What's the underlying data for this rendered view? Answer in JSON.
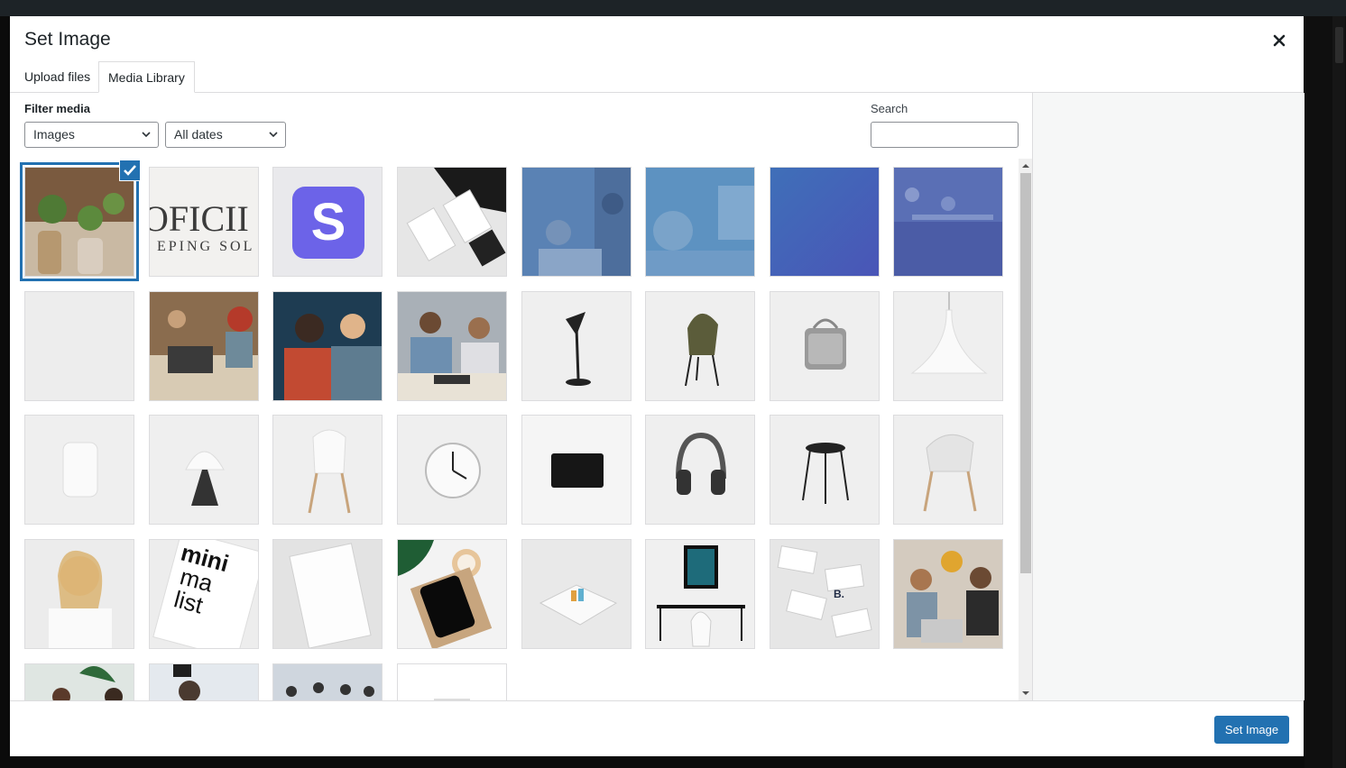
{
  "modal": {
    "title": "Set Image",
    "tabs": [
      {
        "label": "Upload files",
        "active": false
      },
      {
        "label": "Media Library",
        "active": true
      }
    ]
  },
  "toolbar": {
    "filter_label": "Filter media",
    "type_select": {
      "value": "Images"
    },
    "date_select": {
      "value": "All dates"
    },
    "search_label": "Search",
    "search_value": ""
  },
  "media_items": [
    {
      "name": "plants-in-vases",
      "selected": true
    },
    {
      "name": "officina-keeping-sol"
    },
    {
      "name": "stripe-logo"
    },
    {
      "name": "business-card-mockup"
    },
    {
      "name": "office-blue-overlay-1"
    },
    {
      "name": "office-blue-overlay-2"
    },
    {
      "name": "solid-blue-gradient"
    },
    {
      "name": "office-blue-overlay-3"
    },
    {
      "name": "blank-light-grey"
    },
    {
      "name": "people-at-laptop"
    },
    {
      "name": "woman-and-man-talking"
    },
    {
      "name": "team-at-table"
    },
    {
      "name": "black-desk-lamp"
    },
    {
      "name": "olive-chair"
    },
    {
      "name": "grey-speaker"
    },
    {
      "name": "white-pendant-lamp"
    },
    {
      "name": "white-speaker"
    },
    {
      "name": "mushroom-lamp"
    },
    {
      "name": "white-chair"
    },
    {
      "name": "wall-clock"
    },
    {
      "name": "black-card"
    },
    {
      "name": "headphones"
    },
    {
      "name": "black-stool"
    },
    {
      "name": "white-armchair"
    },
    {
      "name": "smiling-woman-phone"
    },
    {
      "name": "minimalist-graphics-book"
    },
    {
      "name": "white-business-card"
    },
    {
      "name": "tablet-with-coffee"
    },
    {
      "name": "folded-brochure"
    },
    {
      "name": "desk-with-frame"
    },
    {
      "name": "b-business-cards"
    },
    {
      "name": "team-with-laptop"
    },
    {
      "name": "women-at-plants"
    },
    {
      "name": "man-with-glasses"
    },
    {
      "name": "crowd-event"
    },
    {
      "name": "blank-white"
    }
  ],
  "footer": {
    "primary_button": "Set Image"
  },
  "colors": {
    "accent": "#2271b1",
    "sidebar_bg": "#f6f7f7",
    "border": "#dcdcde"
  }
}
